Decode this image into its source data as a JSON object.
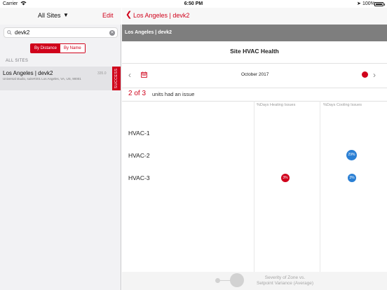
{
  "status_bar": {
    "carrier": "Carrier",
    "time": "6:50 PM",
    "battery": "100%"
  },
  "sidebar": {
    "title": "All Sites",
    "edit_label": "Edit",
    "search": {
      "value": "devk2"
    },
    "sort": {
      "by_distance": "By Distance",
      "by_name": "By Name"
    },
    "section_label": "ALL SITES",
    "sites": [
      {
        "name": "Los Angeles | devk2",
        "distance": "335.0",
        "address": "Universal studio, suite#201 Los Angeles, VA, US, 90001",
        "status": "SUCCESS"
      }
    ]
  },
  "header": {
    "back_label": "Los Angeles | devk2",
    "section_title": "Los Angeles | devk2"
  },
  "card": {
    "title": "Site HVAC Health",
    "month": "October 2017",
    "issue_count": "2 of 3",
    "issue_text": "units had an issue",
    "columns": [
      "%Days Heating Issues",
      "%Days Cooling Issues"
    ],
    "units": [
      {
        "name": "HVAC-1",
        "heating": null,
        "cooling": null
      },
      {
        "name": "HVAC-2",
        "heating": null,
        "cooling": "29%"
      },
      {
        "name": "HVAC-3",
        "heating": "3%",
        "cooling": "3%"
      }
    ],
    "legend": [
      "Severity of Zone vs.",
      "Setpoint Variance (Average)"
    ]
  },
  "colors": {
    "accent": "#d0021b",
    "cooling": "#2a7fd4",
    "heating": "#d0021b"
  },
  "icons": [
    "wifi-icon",
    "location-icon",
    "battery-icon",
    "dropdown-caret-icon",
    "search-icon",
    "clear-icon",
    "back-chevron-icon",
    "prev-chevron-icon",
    "calendar-icon",
    "share-icon",
    "next-chevron-icon"
  ]
}
